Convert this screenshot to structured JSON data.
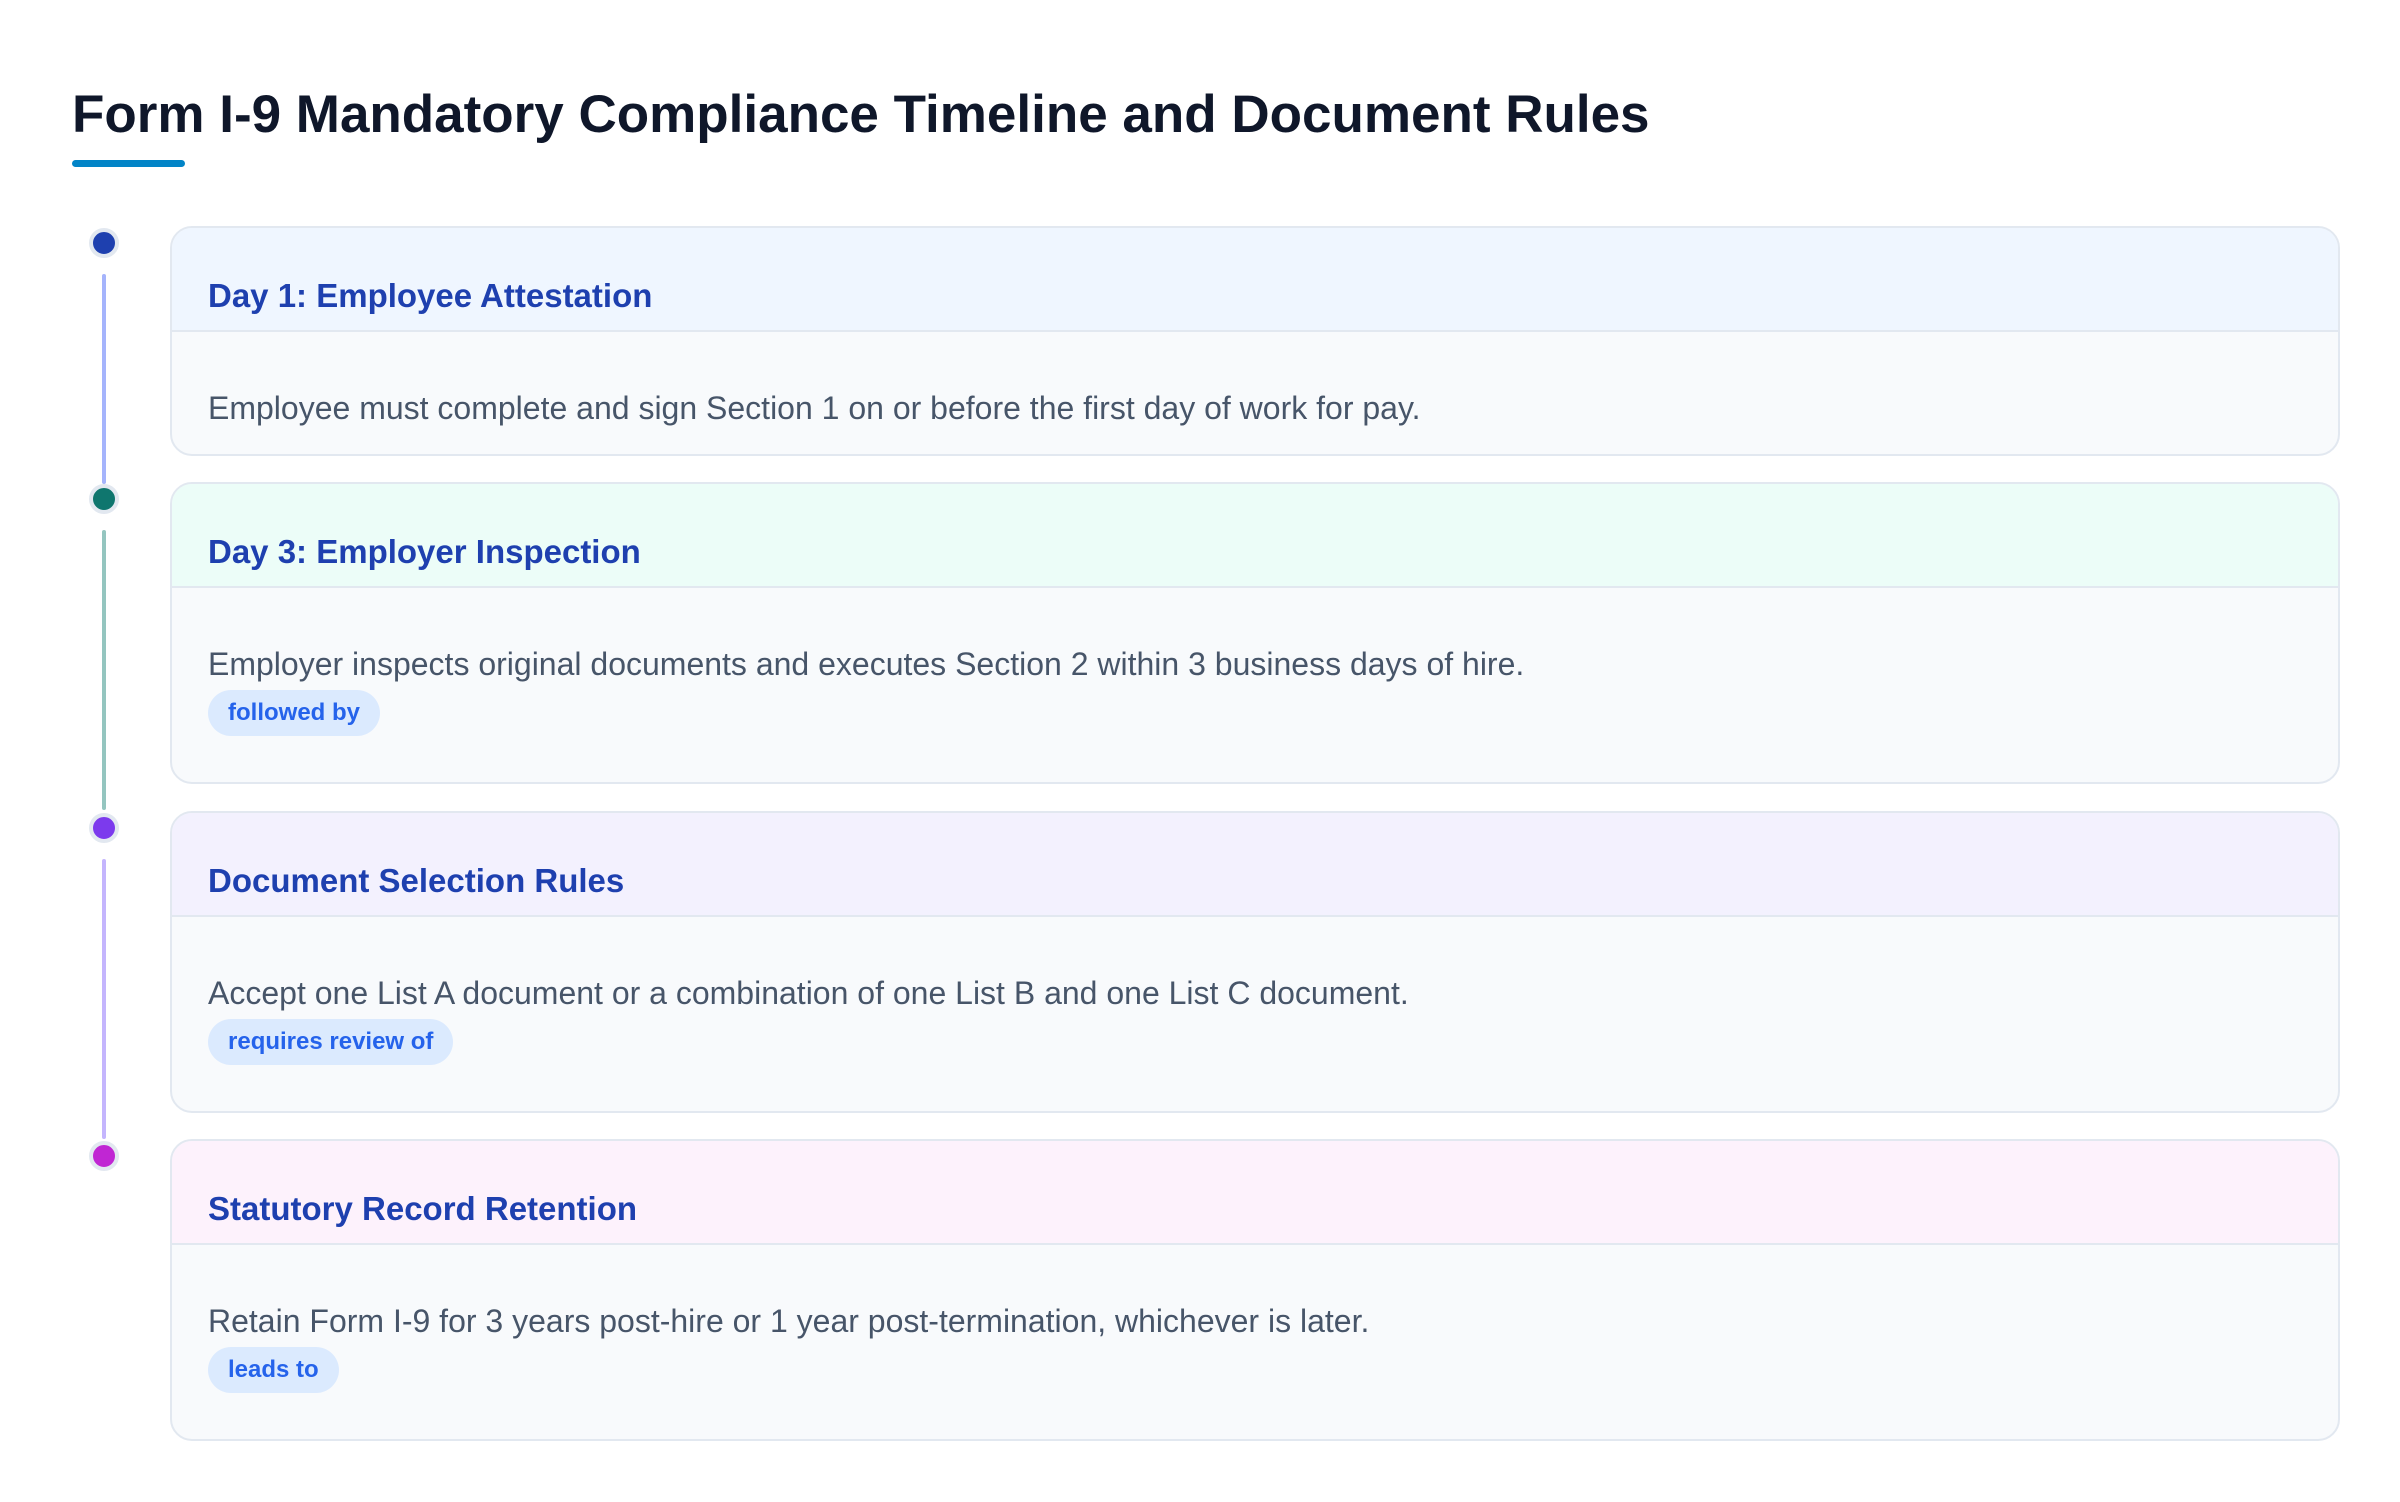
{
  "page": {
    "title": "Form I-9 Mandatory Compliance Timeline and Document Rules",
    "accent_color": "#0284c7"
  },
  "steps": [
    {
      "title": "Day 1: Employee Attestation",
      "description": "Employee must complete and sign Section 1 on or before the first day of work for pay.",
      "badge": "",
      "marker_color": "#1e40af",
      "connector_color": "#a5b4fc",
      "header_color": "#eff6ff"
    },
    {
      "title": "Day 3: Employer Inspection",
      "description": "Employer inspects original documents and executes Section 2 within 3 business days of hire.",
      "badge": "followed by",
      "marker_color": "#0f766e",
      "connector_color": "#94c5bf",
      "header_color": "#ecfdf8"
    },
    {
      "title": "Document Selection Rules",
      "description": "Accept one List A document or a combination of one List B and one List C document.",
      "badge": "requires review of",
      "marker_color": "#7c3aed",
      "connector_color": "#c4b5fd",
      "header_color": "#f3f1fe"
    },
    {
      "title": "Statutory Record Retention",
      "description": "Retain Form I-9 for 3 years post-hire or 1 year post-termination, whichever is later.",
      "badge": "leads to",
      "marker_color": "#c026d3",
      "connector_color": "",
      "header_color": "#fdf2fc"
    }
  ]
}
